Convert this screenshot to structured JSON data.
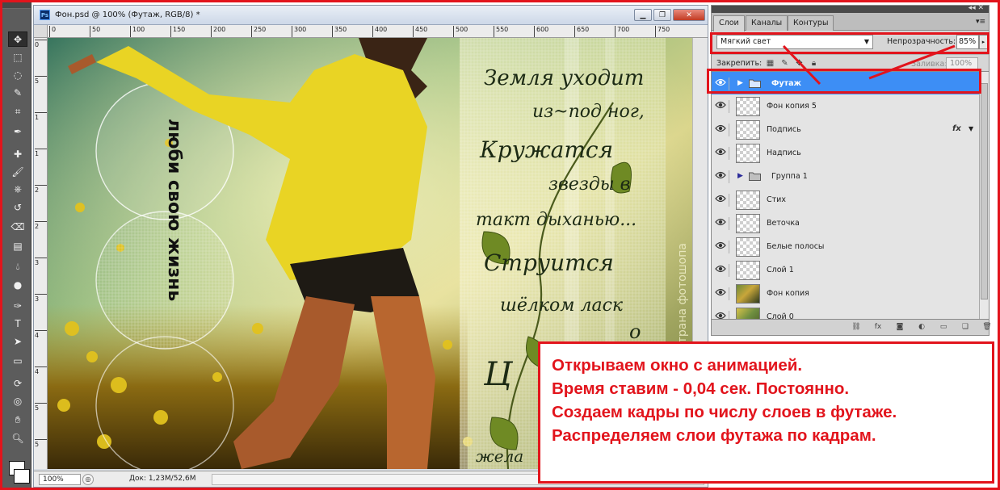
{
  "document": {
    "badge": "Ps",
    "title": "Фон.psd @ 100% (Футаж, RGB/8) *",
    "ruler_top_ticks": [
      "0",
      "50",
      "100",
      "150",
      "200",
      "250",
      "300",
      "350",
      "400",
      "450",
      "500",
      "550",
      "600",
      "650",
      "700",
      "750"
    ],
    "ruler_left_ticks": [
      "0",
      "5",
      "1",
      "1",
      "2",
      "2",
      "3",
      "3",
      "4",
      "4",
      "5",
      "5"
    ],
    "zoom": "100%",
    "doc_size": "Док: 1,23M/52,6M",
    "window_buttons": [
      "minimize",
      "restore",
      "close"
    ]
  },
  "canvas_art": {
    "vertical_slogan": "люби свою жизнь",
    "side_caption": "страна фотошопа",
    "poem_lines": [
      "Земля уходит",
      "из~под ног,",
      "Кружатся",
      "звезды в",
      "такт дыханью...",
      "Струится",
      "шёлком ласк",
      "о",
      "Ц",
      "жела"
    ]
  },
  "layers_panel": {
    "tabs": [
      {
        "label": "Слои",
        "active": true
      },
      {
        "label": "Каналы",
        "active": false
      },
      {
        "label": "Контуры",
        "active": false
      }
    ],
    "blend_mode": "Мягкий свет",
    "opacity_label": "Непрозрачность:",
    "opacity_value": "85%",
    "lock_label": "Закрепить:",
    "fill_label": "Заливка:",
    "fill_value": "100%",
    "layers": [
      {
        "name": "Футаж",
        "kind": "group",
        "selected": true,
        "visible": true
      },
      {
        "name": "Фон копия 5",
        "kind": "layer",
        "thumb": "transparent",
        "visible": true
      },
      {
        "name": "Подпись",
        "kind": "layer",
        "thumb": "transparent",
        "visible": true,
        "fx": "fx"
      },
      {
        "name": "Надпись",
        "kind": "layer",
        "thumb": "transparent",
        "visible": true
      },
      {
        "name": "Группа 1",
        "kind": "group",
        "visible": true
      },
      {
        "name": "Стих",
        "kind": "layer",
        "thumb": "transparent",
        "visible": true
      },
      {
        "name": "Веточка",
        "kind": "layer",
        "thumb": "transparent",
        "visible": true
      },
      {
        "name": "Белые полосы",
        "kind": "layer",
        "thumb": "transparent",
        "visible": true
      },
      {
        "name": "Слой 1",
        "kind": "layer",
        "thumb": "transparent",
        "visible": true
      },
      {
        "name": "Фон копия",
        "kind": "layer",
        "thumb": "photo",
        "visible": true
      },
      {
        "name": "Слой 0",
        "kind": "layer",
        "thumb": "photo2",
        "visible": true
      }
    ],
    "footer_icons": [
      "link-icon",
      "fx-icon",
      "mask-icon",
      "adjustment-icon",
      "folder-icon",
      "new-layer-icon",
      "trash-icon"
    ]
  },
  "instructions": [
    "Открываем окно с анимацией.",
    "Время ставим - 0,04 сек. Постоянно.",
    "Создаем кадры по числу слоев в футаже.",
    "Распределяем слои футажа по кадрам."
  ],
  "colors": {
    "highlight": "#e2141c",
    "selected_layer": "#3d8ef5",
    "toolbox": "#5c5c5c"
  },
  "tools": [
    "move-tool",
    "marquee-tool",
    "lasso-tool",
    "quick-select-tool",
    "crop-tool",
    "eyedropper-tool",
    "healing-tool",
    "brush-tool",
    "stamp-tool",
    "history-brush-tool",
    "eraser-tool",
    "gradient-tool",
    "blur-tool",
    "dodge-tool",
    "pen-tool",
    "type-tool",
    "path-select-tool",
    "shape-tool",
    "3d-rotate-tool",
    "3d-orbit-tool",
    "hand-tool",
    "zoom-tool"
  ]
}
